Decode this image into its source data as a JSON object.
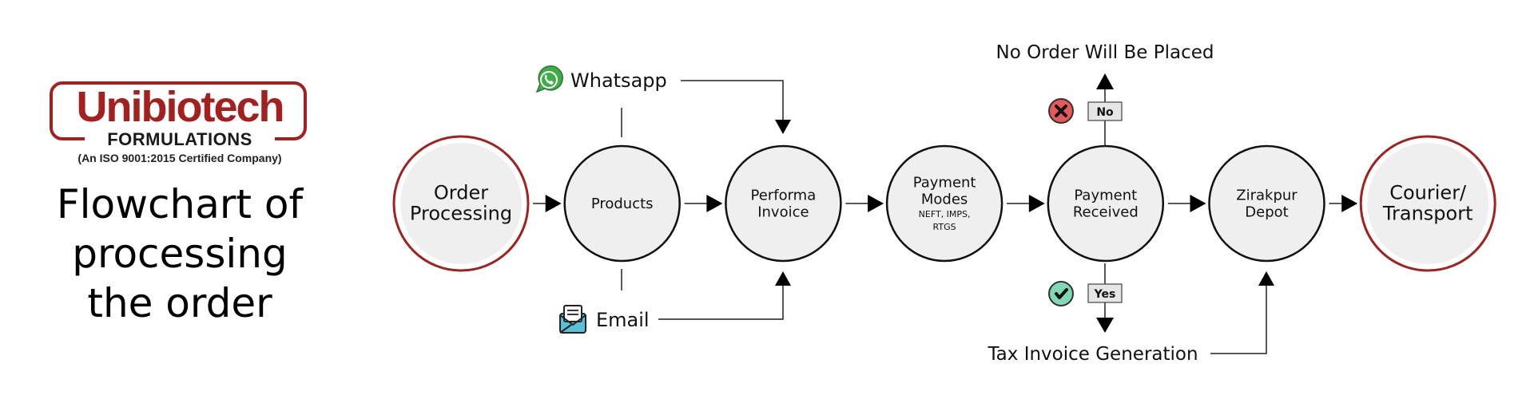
{
  "logo": {
    "brand": "Unibiotech",
    "subtitle": "FORMULATIONS",
    "certification": "(An ISO 9001:2015 Certified Company)",
    "brand_color": "#a3201f"
  },
  "title": {
    "lines": [
      "Flowchart of",
      "processing",
      "the order"
    ]
  },
  "flow": {
    "nodes": [
      {
        "id": "order-processing",
        "lines": [
          "Order",
          "Processing"
        ],
        "sub": [],
        "style": "terminal"
      },
      {
        "id": "products",
        "lines": [
          "Products"
        ],
        "sub": [],
        "style": "step"
      },
      {
        "id": "performa-invoice",
        "lines": [
          "Performa",
          "Invoice"
        ],
        "sub": [],
        "style": "step"
      },
      {
        "id": "payment-modes",
        "lines": [
          "Payment",
          "Modes"
        ],
        "sub": [
          "NEFT, IMPS,",
          "RTGS"
        ],
        "style": "step"
      },
      {
        "id": "payment-received",
        "lines": [
          "Payment",
          "Received"
        ],
        "sub": [],
        "style": "step"
      },
      {
        "id": "zirakpur-depot",
        "lines": [
          "Zirakpur",
          "Depot"
        ],
        "sub": [],
        "style": "step"
      },
      {
        "id": "courier-transport",
        "lines": [
          "Courier/",
          "Transport"
        ],
        "sub": [],
        "style": "terminal"
      }
    ],
    "channels": {
      "whatsapp": {
        "label": "Whatsapp",
        "icon": "whatsapp-icon",
        "color": "#3fae49"
      },
      "email": {
        "label": "Email",
        "icon": "email-icon",
        "color": "#5bc0d6"
      }
    },
    "decision": {
      "no_label": "No",
      "no_outcome": "No Order Will Be Placed",
      "no_icon_color": "#e85a5a",
      "yes_label": "Yes",
      "yes_outcome": "Tax Invoice Generation",
      "yes_icon_color": "#7fd8b6"
    },
    "colors": {
      "node_fill": "#efefef",
      "node_stroke": "#111111",
      "terminal_stroke": "#a3201f",
      "label_box_fill": "#e6e6e6"
    }
  }
}
